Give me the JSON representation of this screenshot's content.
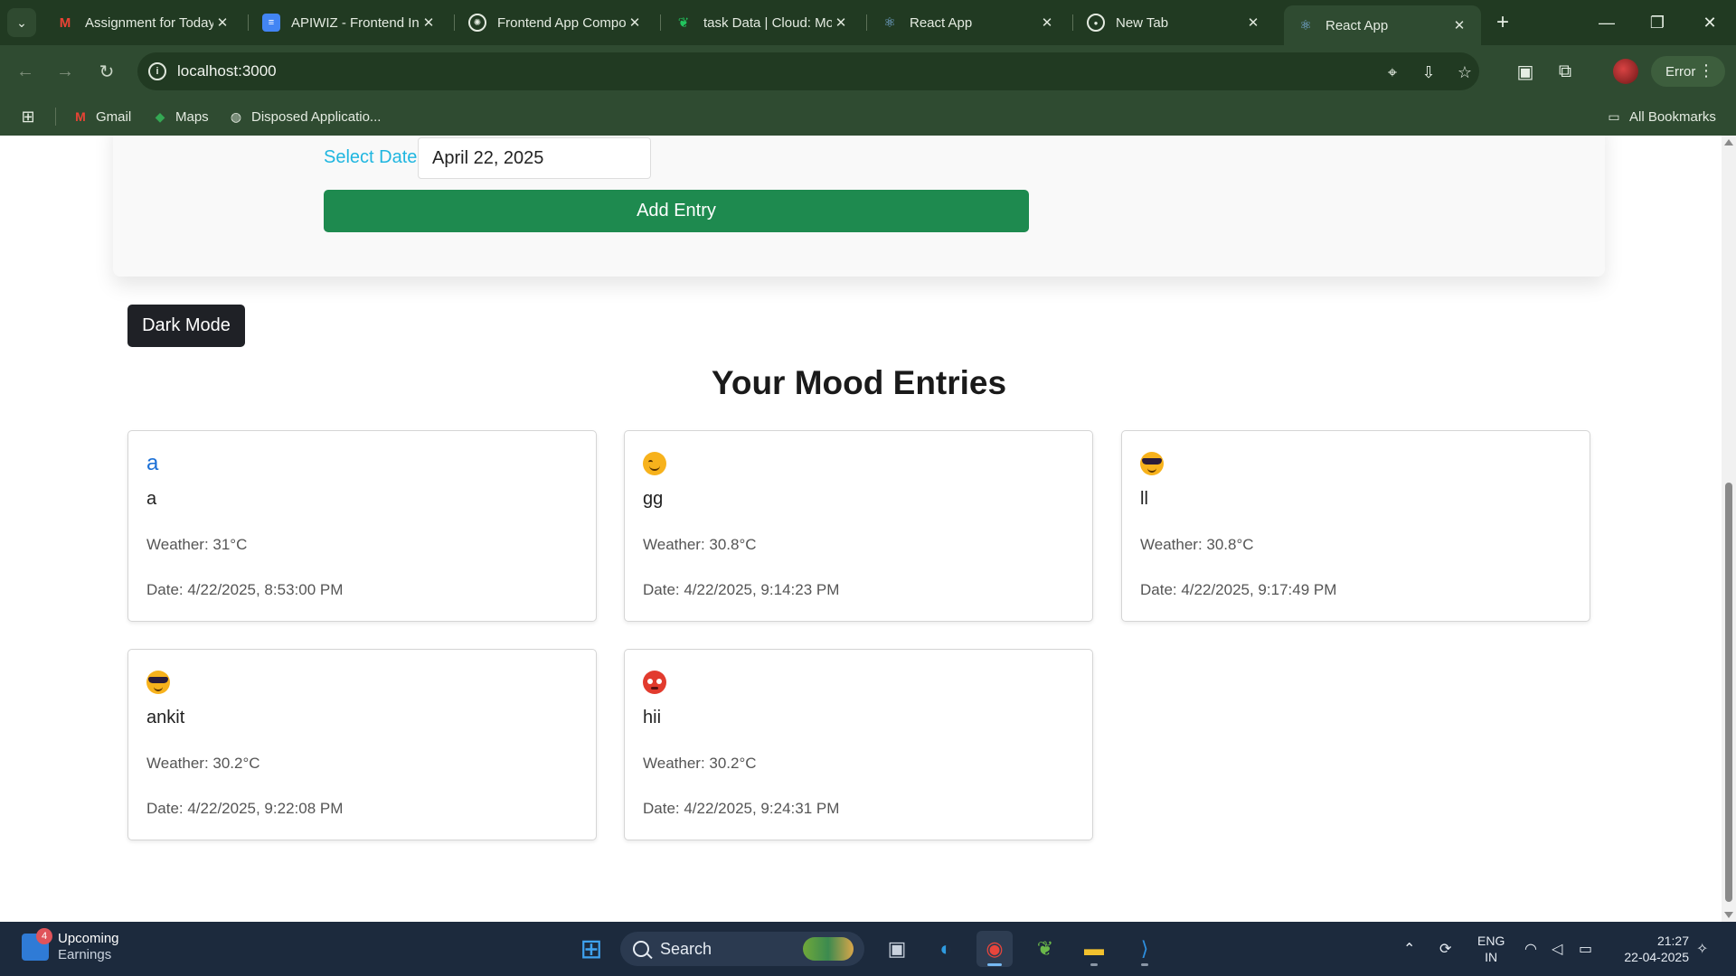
{
  "browser": {
    "tabs": [
      {
        "title": "Assignment for Today",
        "icon": "gmail-icon"
      },
      {
        "title": "APIWIZ - Frontend In",
        "icon": "docs-icon"
      },
      {
        "title": "Frontend App Compo",
        "icon": "chatgpt-icon"
      },
      {
        "title": "task Data | Cloud: Mo",
        "icon": "mongodb-icon"
      },
      {
        "title": "React App",
        "icon": "react-icon"
      },
      {
        "title": "New Tab",
        "icon": "chrome-icon"
      },
      {
        "title": "React App",
        "icon": "react-icon",
        "active": true
      }
    ],
    "url": "localhost:3000",
    "error_label": "Error",
    "bookmarks": [
      {
        "label": "Gmail",
        "icon": "gmail-icon"
      },
      {
        "label": "Maps",
        "icon": "maps-icon"
      },
      {
        "label": "Disposed Applicatio...",
        "icon": "globe-icon"
      }
    ],
    "all_bookmarks_label": "All Bookmarks"
  },
  "form": {
    "date_label": "Select Date:",
    "date_value": "April 22, 2025",
    "add_button": "Add Entry"
  },
  "dark_mode_button": "Dark Mode",
  "entries_heading": "Your Mood Entries",
  "entries": [
    {
      "mood": "a",
      "mood_type": "text",
      "note": "a",
      "weather": "Weather: 31°C",
      "date": "Date: 4/22/2025, 8:53:00 PM"
    },
    {
      "mood": "smiling-face",
      "mood_type": "emoji-smile",
      "note": "gg",
      "weather": "Weather: 30.8°C",
      "date": "Date: 4/22/2025, 9:14:23 PM"
    },
    {
      "mood": "sunglasses-face",
      "mood_type": "emoji-cool",
      "note": "ll",
      "weather": "Weather: 30.8°C",
      "date": "Date: 4/22/2025, 9:17:49 PM"
    },
    {
      "mood": "sunglasses-face",
      "mood_type": "emoji-cool",
      "note": "ankit",
      "weather": "Weather: 30.2°C",
      "date": "Date: 4/22/2025, 9:22:08 PM"
    },
    {
      "mood": "angry-face",
      "mood_type": "emoji-angry",
      "note": "hii",
      "weather": "Weather: 30.2°C",
      "date": "Date: 4/22/2025, 9:24:31 PM"
    }
  ],
  "taskbar": {
    "widget_title": "Upcoming",
    "widget_subtitle": "Earnings",
    "widget_badge": "4",
    "search_label": "Search",
    "lang_line1": "ENG",
    "lang_line2": "IN",
    "time": "21:27",
    "date": "22-04-2025"
  },
  "colors": {
    "chrome_dark": "#213a22",
    "chrome_toolbar": "#2f4b31",
    "accent_green": "#1e8a4f",
    "label_cyan": "#1fb6e0",
    "taskbar": "#1c2a3d"
  }
}
